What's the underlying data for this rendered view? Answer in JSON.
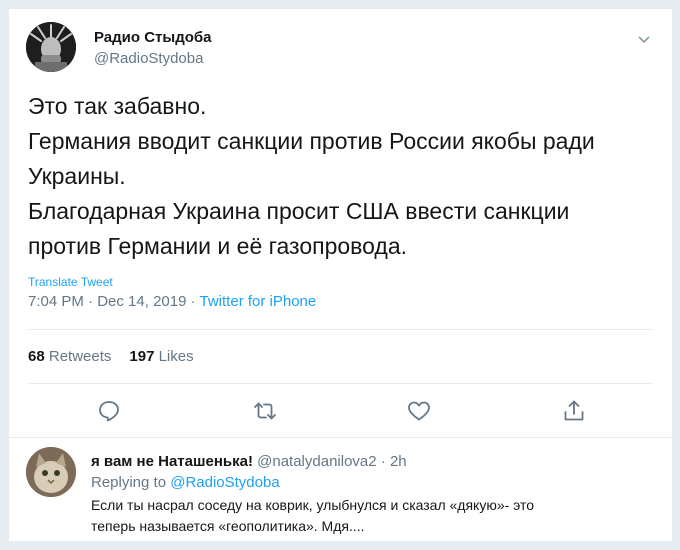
{
  "tweet": {
    "author": {
      "name": "Радио Стыдоба",
      "handle": "@RadioStydoba"
    },
    "text_lines": [
      "Это так забавно.",
      "Германия вводит санкции против России якобы ради",
      "Украины.",
      "Благодарная Украина просит США ввести санкции",
      "против Германии и её газопровода."
    ],
    "translate_label": "Translate Tweet",
    "time": "7:04 PM",
    "date": "Dec 14, 2019",
    "separator": " · ",
    "source": "Twitter for iPhone",
    "retweets": {
      "count": "68",
      "label": "Retweets"
    },
    "likes": {
      "count": "197",
      "label": "Likes"
    },
    "actions": [
      "reply-icon",
      "retweet-icon",
      "like-icon",
      "share-icon"
    ]
  },
  "reply": {
    "name": "я вам не Наташенька!",
    "handle": "@natalydanilova2",
    "dot": " · ",
    "age": "2h",
    "replying_prefix": "Replying to",
    "replying_to": "@RadioStydoba",
    "text_lines": [
      "Если ты насрал соседу на коврик, улыбнулся и сказал «дякую»- это",
      "теперь называется «геополитика». Мдя...."
    ]
  },
  "colors": {
    "accent": "#1da1f2",
    "text": "#14171a",
    "secondary": "#657786",
    "border": "#e6ecf0"
  }
}
